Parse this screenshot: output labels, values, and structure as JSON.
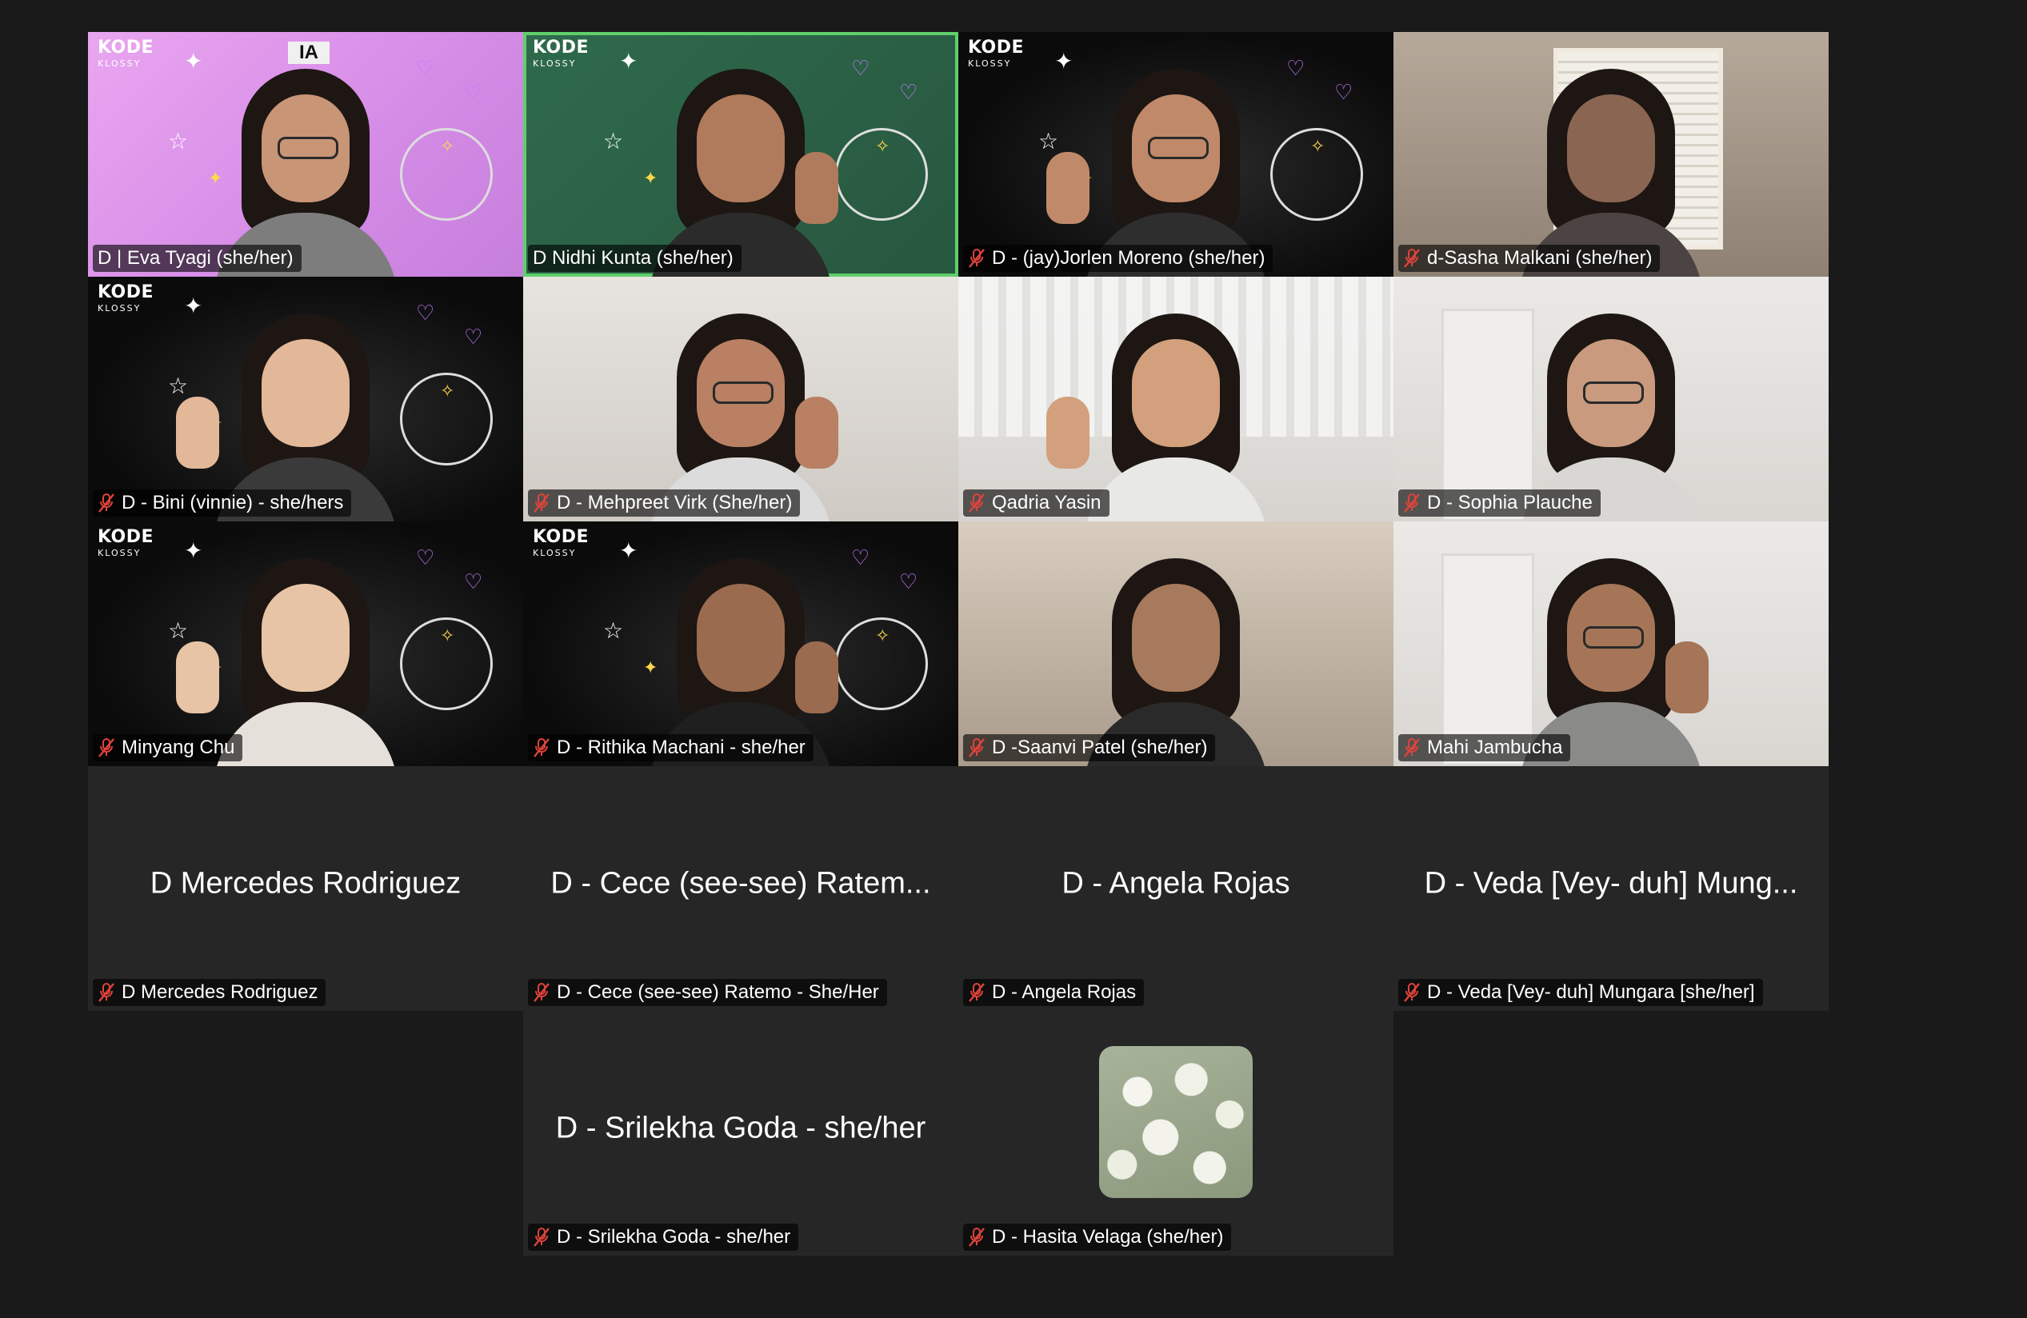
{
  "participants": [
    {
      "label": "D | Eva Tyagi (she/her)",
      "muted": false,
      "view": "video",
      "bg": "kk-pink",
      "tag": "IA"
    },
    {
      "label": "D Nidhi Kunta (she/her)",
      "muted": false,
      "view": "video",
      "bg": "kk-green",
      "active_speaker": true
    },
    {
      "label": "D - (jay)Jorlen Moreno (she/her)",
      "muted": true,
      "view": "video",
      "bg": "kk-black"
    },
    {
      "label": "d-Sasha Malkani (she/her)",
      "muted": true,
      "view": "video",
      "bg": "room-beige"
    },
    {
      "label": "D - Bini (vinnie) - she/hers",
      "muted": true,
      "view": "video",
      "bg": "kk-black"
    },
    {
      "label": "D - Mehpreet Virk (She/her)",
      "muted": true,
      "view": "video",
      "bg": "room-white"
    },
    {
      "label": "Qadria Yasin",
      "muted": true,
      "view": "video",
      "bg": "room-curtain"
    },
    {
      "label": "D - Sophia Plauche",
      "muted": true,
      "view": "video",
      "bg": "room-wall"
    },
    {
      "label": "Minyang Chu",
      "muted": true,
      "view": "video",
      "bg": "kk-black"
    },
    {
      "label": "D - Rithika Machani - she/her",
      "muted": true,
      "view": "video",
      "bg": "kk-black"
    },
    {
      "label": "D -Saanvi Patel (she/her)",
      "muted": true,
      "view": "video",
      "bg": "room-warm"
    },
    {
      "label": "Mahi Jambucha",
      "muted": true,
      "view": "video",
      "bg": "room-wall"
    },
    {
      "label": "D Mercedes Rodriguez",
      "display_name": "D Mercedes Rodriguez",
      "muted": true,
      "view": "name"
    },
    {
      "label": "D - Cece (see-see) Ratemo - She/Her",
      "display_name": "D - Cece (see-see) Ratem...",
      "muted": true,
      "view": "name"
    },
    {
      "label": "D - Angela Rojas",
      "display_name": "D - Angela Rojas",
      "muted": true,
      "view": "name"
    },
    {
      "label": "D - Veda [Vey- duh] Mungara [she/her]",
      "display_name": "D - Veda [Vey- duh] Mung...",
      "muted": true,
      "view": "name"
    },
    {
      "label": "D - Srilekha Goda - she/her",
      "display_name": "D - Srilekha Goda - she/her",
      "muted": true,
      "view": "name"
    },
    {
      "label": "D - Hasita Velaga (she/her)",
      "muted": true,
      "view": "avatar",
      "avatar_icon": "tulip-photo-avatar"
    }
  ],
  "kk_logo": {
    "line1": "KODE",
    "line2": "KLOSSY"
  },
  "icons": {
    "mute": "muted-microphone-icon"
  },
  "colors": {
    "active_border": "#5fcf6a",
    "mute_red": "#e0433b",
    "tile_bg": "#262626",
    "page_bg": "#1a1a1b"
  }
}
